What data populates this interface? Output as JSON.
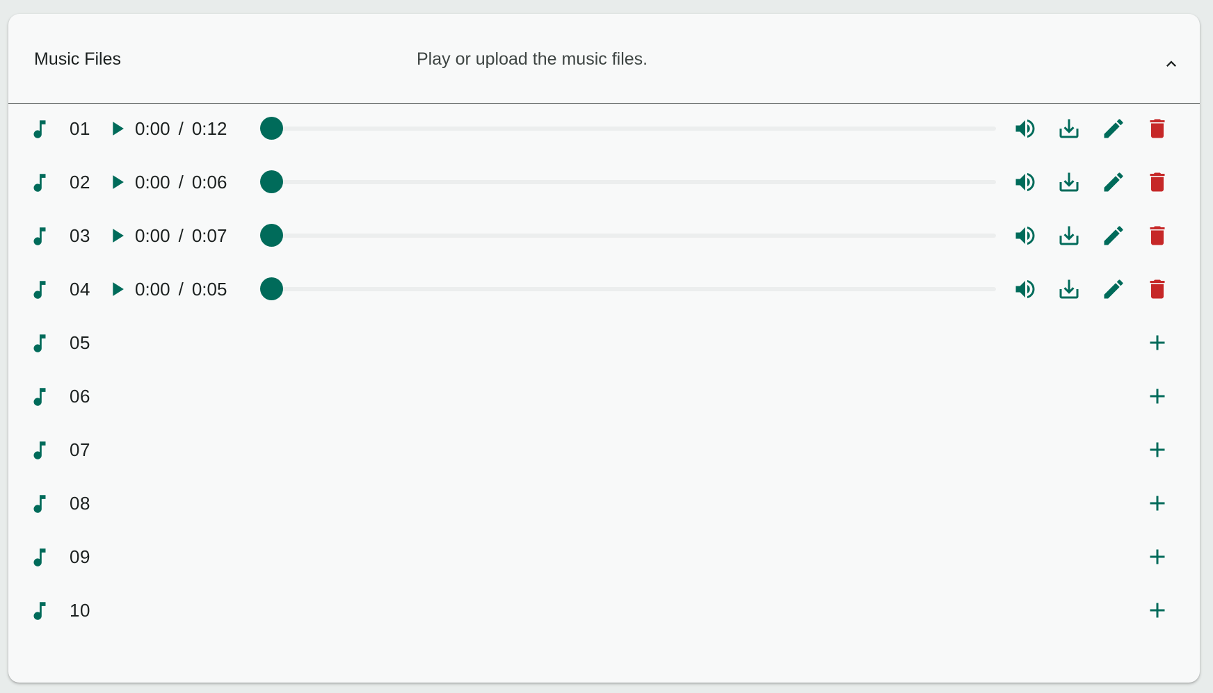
{
  "header": {
    "title": "Music Files",
    "subtitle": "Play or upload the music files."
  },
  "colors": {
    "accent": "#006b5a",
    "delete": "#c62828",
    "background": "#f8f9f9"
  },
  "time_separator": "/",
  "tracks": [
    {
      "number": "01",
      "has_file": true,
      "current": "0:00",
      "duration": "0:12",
      "progress": 0
    },
    {
      "number": "02",
      "has_file": true,
      "current": "0:00",
      "duration": "0:06",
      "progress": 0
    },
    {
      "number": "03",
      "has_file": true,
      "current": "0:00",
      "duration": "0:07",
      "progress": 0
    },
    {
      "number": "04",
      "has_file": true,
      "current": "0:00",
      "duration": "0:05",
      "progress": 0
    },
    {
      "number": "05",
      "has_file": false
    },
    {
      "number": "06",
      "has_file": false
    },
    {
      "number": "07",
      "has_file": false
    },
    {
      "number": "08",
      "has_file": false
    },
    {
      "number": "09",
      "has_file": false
    },
    {
      "number": "10",
      "has_file": false
    }
  ],
  "icons": {
    "track": "music-note-icon",
    "play": "play-icon",
    "volume": "volume-icon",
    "download": "download-icon",
    "edit": "pencil-icon",
    "delete": "trash-icon",
    "add": "plus-icon",
    "collapse": "chevron-up-icon"
  }
}
